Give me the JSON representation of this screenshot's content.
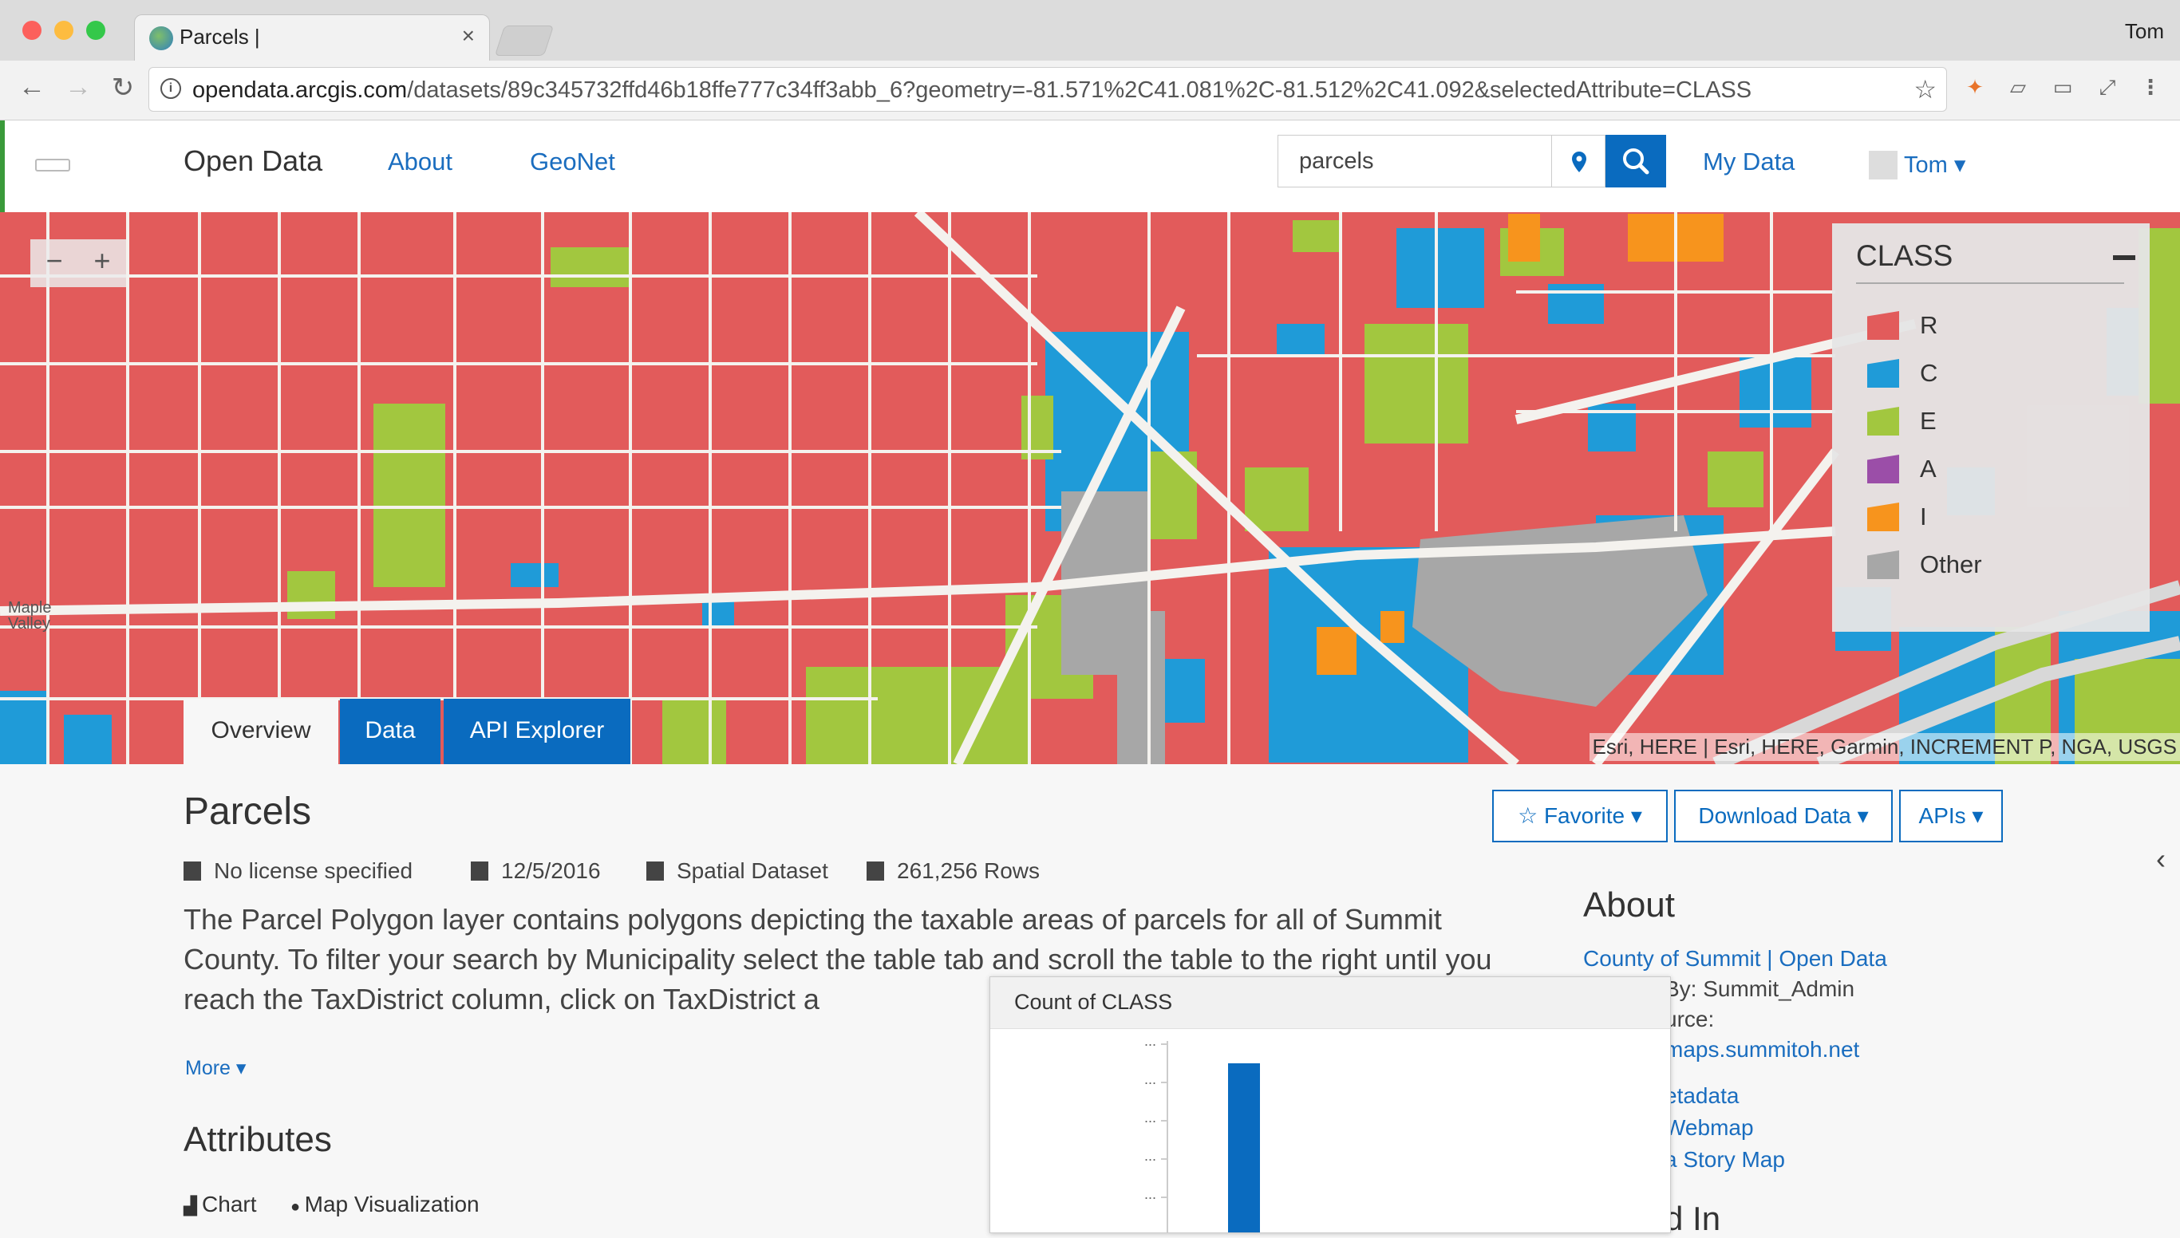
{
  "browser": {
    "tab_title": "Parcels |",
    "tab_close": "×",
    "profile_name": "Tom",
    "url_host": "opendata.arcgis.com",
    "url_path": "/datasets/89c345732ffd46b18ffe777c34ff3abb_6?geometry=-81.571%2C41.081%2C-81.512%2C41.092&selectedAttribute=CLASS"
  },
  "header": {
    "brand": "Open Data",
    "nav": [
      "About",
      "GeoNet"
    ],
    "search_value": "parcels",
    "my_data": "My Data",
    "user": "Tom ▾"
  },
  "map": {
    "zoom_out": "−",
    "zoom_in": "+",
    "place_label": "Maple Valley",
    "attribution": "Esri, HERE | Esri, HERE, Garmin, INCREMENT P, NGA, USGS"
  },
  "legend": {
    "title": "CLASS",
    "items": [
      {
        "label": "R",
        "color": "#e25b5b"
      },
      {
        "label": "C",
        "color": "#1f9bd8"
      },
      {
        "label": "E",
        "color": "#a2c73f"
      },
      {
        "label": "A",
        "color": "#9b4ea8"
      },
      {
        "label": "I",
        "color": "#f7941d"
      },
      {
        "label": "Other",
        "color": "#a7a7a7"
      }
    ]
  },
  "tabs": [
    "Overview",
    "Data",
    "API Explorer"
  ],
  "dataset": {
    "title": "Parcels",
    "license": "No license specified",
    "date": "12/5/2016",
    "type": "Spatial Dataset",
    "rows": "261,256 Rows",
    "description": "The Parcel Polygon layer contains polygons depicting the taxable areas of parcels for all of Summit County. To filter your search by Municipality select the table tab and scroll the table to the right until you reach the TaxDistrict column, click on TaxDistrict a",
    "more": "More ▾"
  },
  "actions": {
    "favorite": "☆ Favorite ▾",
    "download": "Download Data ▾",
    "apis": "APIs ▾"
  },
  "about": {
    "heading": "About",
    "org_link": "County of Summit | Open Data",
    "by": "By: Summit_Admin",
    "source_label": "urce:",
    "source_link": "maps.summitoh.net",
    "links": [
      "etadata",
      "Webmap",
      "a Story Map"
    ],
    "partial_heading": "d In"
  },
  "attributes": {
    "heading": "Attributes",
    "chart_tab": "Chart",
    "mapviz_tab": "Map Visualization"
  },
  "chart_data": {
    "type": "bar",
    "title": "Count of CLASS",
    "tick_labels": [
      "...",
      "...",
      "...",
      "...",
      "..."
    ],
    "values": [
      1
    ]
  },
  "colors": {
    "accent": "#0a6bbf",
    "residential": "#e25b5b",
    "commercial": "#1f9bd8",
    "exempt": "#a2c73f",
    "industrial": "#f7941d",
    "other": "#a7a7a7"
  }
}
